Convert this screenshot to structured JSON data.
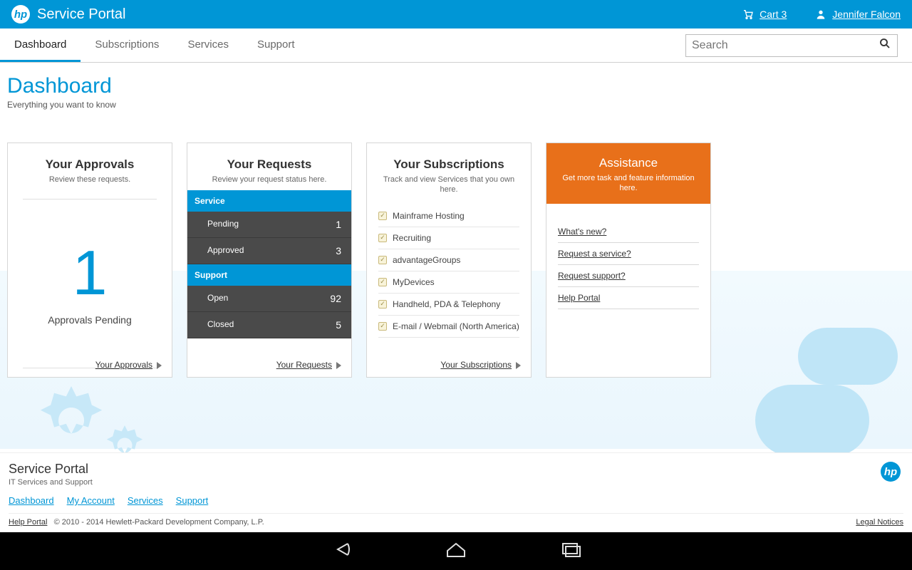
{
  "header": {
    "brand": "Service Portal",
    "cart_label": "Cart 3",
    "user_name": "Jennifer Falcon"
  },
  "nav": {
    "tabs": [
      "Dashboard",
      "Subscriptions",
      "Services",
      "Support"
    ],
    "active": "Dashboard",
    "search_placeholder": "Search"
  },
  "page": {
    "title": "Dashboard",
    "subtitle": "Everything you want to know"
  },
  "approvals": {
    "title": "Your Approvals",
    "subtitle": "Review these requests.",
    "count": "1",
    "count_label": "Approvals Pending",
    "link": "Your Approvals"
  },
  "requests": {
    "title": "Your Requests",
    "subtitle": "Review your request status here.",
    "sections": [
      {
        "name": "Service",
        "rows": [
          {
            "label": "Pending",
            "value": "1"
          },
          {
            "label": "Approved",
            "value": "3"
          }
        ]
      },
      {
        "name": "Support",
        "rows": [
          {
            "label": "Open",
            "value": "92"
          },
          {
            "label": "Closed",
            "value": "5"
          }
        ]
      }
    ],
    "link": "Your Requests"
  },
  "subscriptions": {
    "title": "Your Subscriptions",
    "subtitle": "Track and view Services that you own here.",
    "items": [
      "Mainframe Hosting",
      "Recruiting",
      "advantageGroups",
      "MyDevices",
      "Handheld, PDA & Telephony",
      "E-mail / Webmail (North America)"
    ],
    "link": "Your Subscriptions"
  },
  "assistance": {
    "title": "Assistance",
    "subtitle": "Get more task and feature information here.",
    "links": [
      "What's new?",
      "Request a service?",
      "Request support?",
      "Help Portal"
    ]
  },
  "footer": {
    "title": "Service Portal",
    "subtitle": "IT Services and Support",
    "links": [
      "Dashboard",
      "My Account",
      "Services",
      "Support"
    ],
    "help": "Help Portal",
    "copyright": "© 2010 - 2014 Hewlett-Packard Development Company, L.P.",
    "legal": "Legal Notices"
  }
}
